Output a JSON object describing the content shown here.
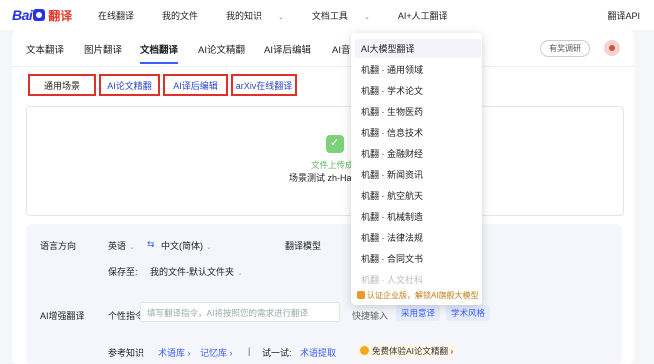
{
  "logo": {
    "bai": "Bai",
    "fanyi": "翻译"
  },
  "nav": {
    "items": [
      {
        "label": "在线翻译",
        "caret": ""
      },
      {
        "label": "我的文件",
        "caret": ""
      },
      {
        "label": "我的知识",
        "caret": "⌄"
      },
      {
        "label": "文档工具",
        "caret": "⌄"
      },
      {
        "label": "AI+人工翻译",
        "caret": ""
      }
    ],
    "api": "翻译API"
  },
  "tabs": [
    {
      "label": "文本翻译"
    },
    {
      "label": "图片翻译"
    },
    {
      "label": "文档翻译"
    },
    {
      "label": "AI论文精翻"
    },
    {
      "label": "AI译后编辑"
    },
    {
      "label": "AI音"
    }
  ],
  "reward_label": "有奖调研",
  "scenarios": [
    "通用场景",
    "AI论文精翻",
    "AI译后编辑",
    "arXiv在线翻译"
  ],
  "upload": {
    "status": "文件上传成功",
    "filename": "场景测试 zh-Hans."
  },
  "settings": {
    "lang_label": "语言方向",
    "source_lang": "英语",
    "swap_icon": "⇆",
    "target_lang": "中文(简体)",
    "model_label": "翻译模型",
    "save_label": "保存至:",
    "save_value": "我的文件-默认文件夹",
    "ai_label": "AI增强翻译",
    "instr_label": "个性指令",
    "instr_placeholder": "填写翻译指令，AI将按照您的需求进行翻译",
    "quick_label": "快捷输入",
    "chip1": "采用意译",
    "chip2": "学术风格",
    "ref_label": "参考知识",
    "ref_term": "术语库",
    "ref_memory": "记忆库",
    "try_label": "试一试:",
    "try_link": "术语提取",
    "promo": "免费体验AI论文精翻"
  },
  "menu": {
    "items": [
      "AI大模型翻译",
      "机翻 · 通用领域",
      "机翻 · 学术论文",
      "机翻 · 生物医药",
      "机翻 · 信息技术",
      "机翻 · 金融财经",
      "机翻 · 新闻资讯",
      "机翻 · 航空航天",
      "机翻 · 机械制造",
      "机翻 · 法律法规",
      "机翻 · 合同文书",
      "机翻 · 人文社科"
    ],
    "footer": "认证企业版，解锁AI旗舰大模型"
  },
  "colors": {
    "accent": "#3b5cff",
    "highlight": "#e0302a",
    "success": "#5bb35b",
    "brand_red": "#e23b2e",
    "brand_blue": "#2932e1"
  }
}
